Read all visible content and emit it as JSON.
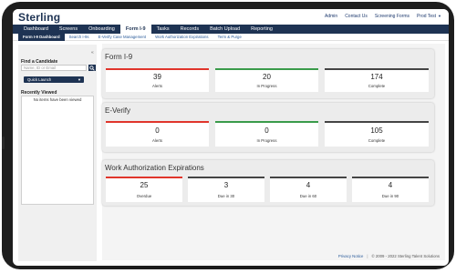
{
  "app": {
    "logo": "Sterling"
  },
  "topbar": {
    "links": [
      "Admin",
      "Contact Us",
      "Screening Forms"
    ],
    "user": "Prod Test"
  },
  "nav": {
    "items": [
      "Dashboard",
      "Screens",
      "Onboarding",
      "Form I-9",
      "Tasks",
      "Records",
      "Batch Upload",
      "Reporting"
    ],
    "active_index": 3
  },
  "subnav": {
    "items": [
      "Form I-9 Dashboard",
      "Search I-9s",
      "E-Verify Case Management",
      "Work Authorization Expirations",
      "Term & Purge"
    ],
    "active_index": 0
  },
  "left": {
    "find_label": "Find a Candidate",
    "find_placeholder": "Name, ID or Email",
    "quick_launch": "Quick Launch",
    "recent_label": "Recently Viewed",
    "recent_empty": "No items have been viewed"
  },
  "sections": {
    "form_i9": {
      "title": "Form I-9",
      "cards": [
        {
          "value": "39",
          "label": "Alerts",
          "accent": "#e0352b"
        },
        {
          "value": "20",
          "label": "In Progress",
          "accent": "#3a9b4a"
        },
        {
          "value": "174",
          "label": "Complete",
          "accent": "#444444"
        }
      ]
    },
    "everify": {
      "title": "E-Verify",
      "cards": [
        {
          "value": "0",
          "label": "Alerts",
          "accent": "#e0352b"
        },
        {
          "value": "0",
          "label": "In Progress",
          "accent": "#3a9b4a"
        },
        {
          "value": "105",
          "label": "Complete",
          "accent": "#444444"
        }
      ]
    },
    "work_auth": {
      "title": "Work Authorization Expirations",
      "cards": [
        {
          "value": "25",
          "label": "Overdue",
          "accent": "#e0352b"
        },
        {
          "value": "3",
          "label": "Due in 30",
          "accent": "#444444"
        },
        {
          "value": "4",
          "label": "Due in 60",
          "accent": "#444444"
        },
        {
          "value": "4",
          "label": "Due in 90",
          "accent": "#444444"
        }
      ]
    }
  },
  "footer": {
    "privacy": "Privacy Notice",
    "copyright": "© 2009 - 2022 Sterling Talent Solutions"
  },
  "colors": {
    "navy": "#1e3353",
    "alert": "#e0352b",
    "progress": "#3a9b4a",
    "neutral": "#444444"
  }
}
